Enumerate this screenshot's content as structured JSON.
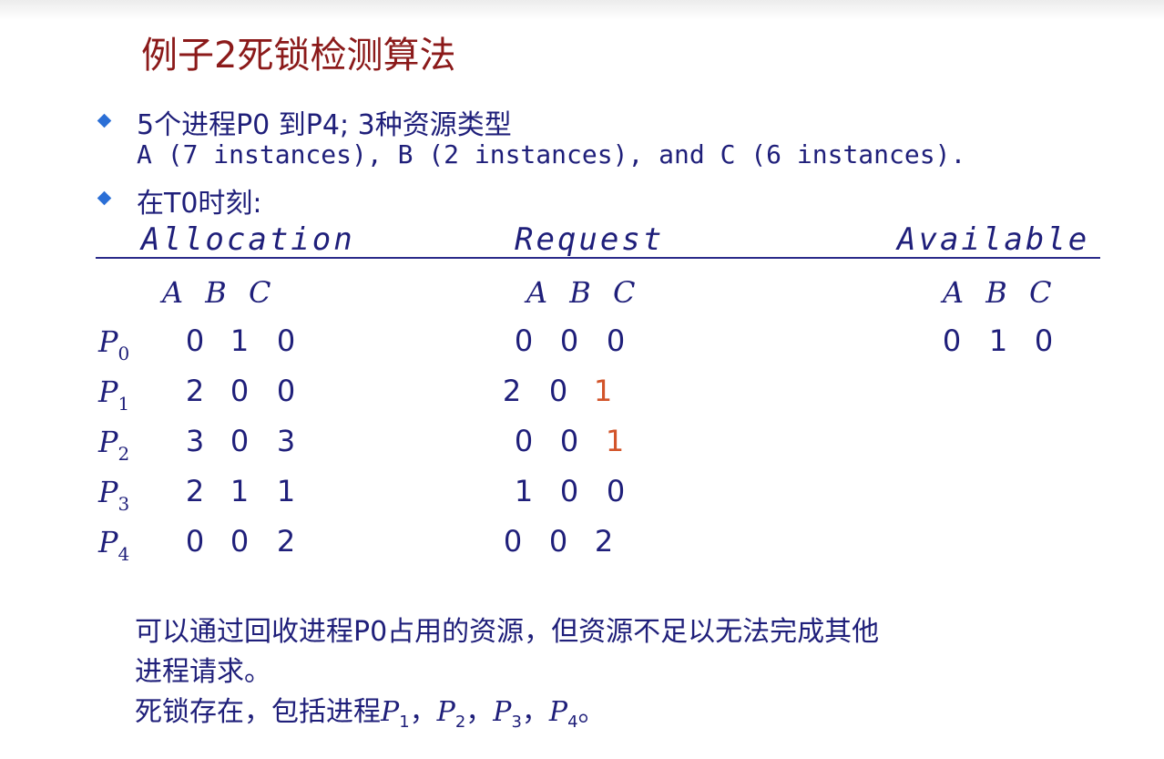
{
  "title": "例子2死锁检测算法",
  "bullets": [
    "5个进程P0 到P4; 3种资源类型",
    "A (7 instances), B (2 instances), and C (6 instances).",
    "在T0时刻:"
  ],
  "headers": {
    "allocation": "Allocation",
    "request": "Request",
    "available": "Available"
  },
  "resource_letters": "A B C",
  "processes": [
    {
      "name": "P",
      "sub": "0",
      "allocation": [
        "0",
        "1",
        "0"
      ],
      "request": [
        "0",
        "0",
        "0"
      ]
    },
    {
      "name": "P",
      "sub": "1",
      "allocation": [
        "2",
        "0",
        "0"
      ],
      "request": [
        "2",
        "0",
        "1"
      ]
    },
    {
      "name": "P",
      "sub": "2",
      "allocation": [
        "3",
        "0",
        "3"
      ],
      "request": [
        "0",
        "0",
        "1"
      ]
    },
    {
      "name": "P",
      "sub": "3",
      "allocation": [
        "2",
        "1",
        "1"
      ],
      "request": [
        "1",
        "0",
        "0"
      ]
    },
    {
      "name": "P",
      "sub": "4",
      "allocation": [
        "0",
        "0",
        "2"
      ],
      "request": [
        "0",
        "0",
        "2"
      ]
    }
  ],
  "available": [
    "0",
    "1",
    "0"
  ],
  "highlight_color": "#d2542a",
  "notes": {
    "line1": "可以通过回收进程P0占用的资源，但资源不足以无法完成其他",
    "line2": "进程请求。",
    "line3_prefix": "死锁存在，包括进程",
    "p": "P",
    "subs": [
      "1",
      "2",
      "3",
      "4"
    ],
    "sep": "，",
    "end": "。"
  }
}
